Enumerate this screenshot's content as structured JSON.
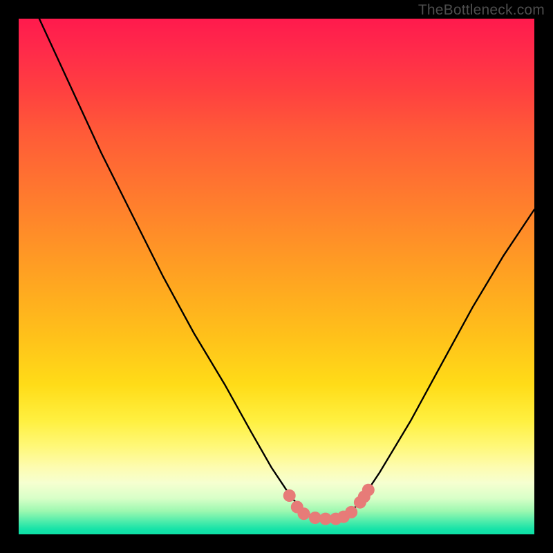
{
  "watermark": "TheBottleneck.com",
  "chart_data": {
    "type": "line",
    "title": "",
    "xlabel": "",
    "ylabel": "",
    "xlim": [
      0,
      100
    ],
    "ylim": [
      0,
      100
    ],
    "series": [
      {
        "name": "bottleneck-curve",
        "x": [
          4,
          10,
          16,
          22,
          28,
          34,
          40,
          45,
          49,
          53,
          56,
          58,
          60,
          62,
          64,
          66,
          70,
          76,
          82,
          88,
          94,
          100
        ],
        "y": [
          100,
          87,
          74,
          62,
          50,
          39,
          29,
          20,
          13,
          7,
          4,
          3,
          3,
          3,
          4,
          6,
          12,
          22,
          33,
          44,
          54,
          63
        ]
      }
    ],
    "markers": {
      "name": "highlight-dots",
      "color": "#e77b78",
      "points": [
        {
          "x": 52.5,
          "y": 7.5
        },
        {
          "x": 54.0,
          "y": 5.3
        },
        {
          "x": 55.3,
          "y": 4.0
        },
        {
          "x": 57.5,
          "y": 3.2
        },
        {
          "x": 59.5,
          "y": 3.0
        },
        {
          "x": 61.5,
          "y": 3.0
        },
        {
          "x": 63.0,
          "y": 3.4
        },
        {
          "x": 64.5,
          "y": 4.3
        },
        {
          "x": 66.2,
          "y": 6.2
        },
        {
          "x": 67.0,
          "y": 7.3
        },
        {
          "x": 67.8,
          "y": 8.6
        }
      ]
    },
    "background_gradient": {
      "top": "#ff1a4d",
      "upper_mid": "#ff8e28",
      "mid": "#ffdc18",
      "lower_mid": "#fdfcb0",
      "bottom": "#0ee0a6"
    }
  }
}
